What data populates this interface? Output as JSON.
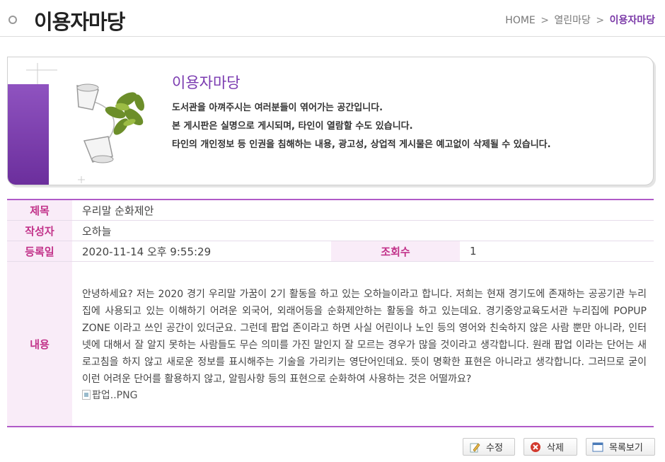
{
  "header": {
    "title": "이용자마당",
    "breadcrumb": {
      "home": "HOME",
      "sep": ">",
      "parent": "열린마당",
      "current": "이용자마당"
    }
  },
  "banner": {
    "heading": "이용자마당",
    "lines": [
      "도서관을 아껴주시는 여러분들이 엮어가는 공간입니다.",
      "본 게시판은 실명으로 게시되며, 타인이 열람할 수도 있습니다.",
      "타인의 개인정보 등 인권을 침해하는 내용, 광고성, 상업적 게시물은 예고없이 삭제될 수 있습니다."
    ]
  },
  "post": {
    "labels": {
      "subject": "제목",
      "author": "작성자",
      "date": "등록일",
      "views": "조회수",
      "content": "내용"
    },
    "subject": "우리말 순화제안",
    "author": "오하늘",
    "date": "2020-11-14 오후 9:55:29",
    "views": "1",
    "content": "안녕하세요? 저는 2020 경기 우리말 가꿈이 2기 활동을 하고 있는 오하늘이라고 합니다. 저희는 현재 경기도에 존재하는 공공기관 누리집에 사용되고 있는 이해하기 어려운 외국어, 외래어등을 순화제안하는 활동을 하고 있는데요. 경기중앙교육도서관 누리집에 POPUP ZONE 이라고 쓰인 공간이 있더군요. 그런데 팝업 존이라고 하면 사실 어린이나 노인 등의 영어와 친숙하지 않은 사람 뿐만 아니라, 인터넷에 대해서 잘 알지 못하는 사람들도 무슨 의미를 가진 말인지 잘 모르는 경우가 많을 것이라고 생각합니다. 원래 팝업 이라는 단어는 새로고침을 하지 않고 새로운 정보를 표시해주는 기술을 가리키는 영단어인데요. 뜻이 명확한 표현은 아니라고 생각합니다. 그러므로 굳이 이런 어려운 단어를 활용하지 않고, 알림사항 등의 표현으로 순화하여 사용하는 것은 어떨까요?",
    "attachment_alt": "팝업..PNG"
  },
  "buttons": {
    "edit": "수정",
    "delete": "삭제",
    "list": "목록보기"
  },
  "colors": {
    "accent": "#7a3ab0",
    "label": "#c2338a",
    "label_bg": "#f9ecf8",
    "border": "#b05ac8"
  }
}
